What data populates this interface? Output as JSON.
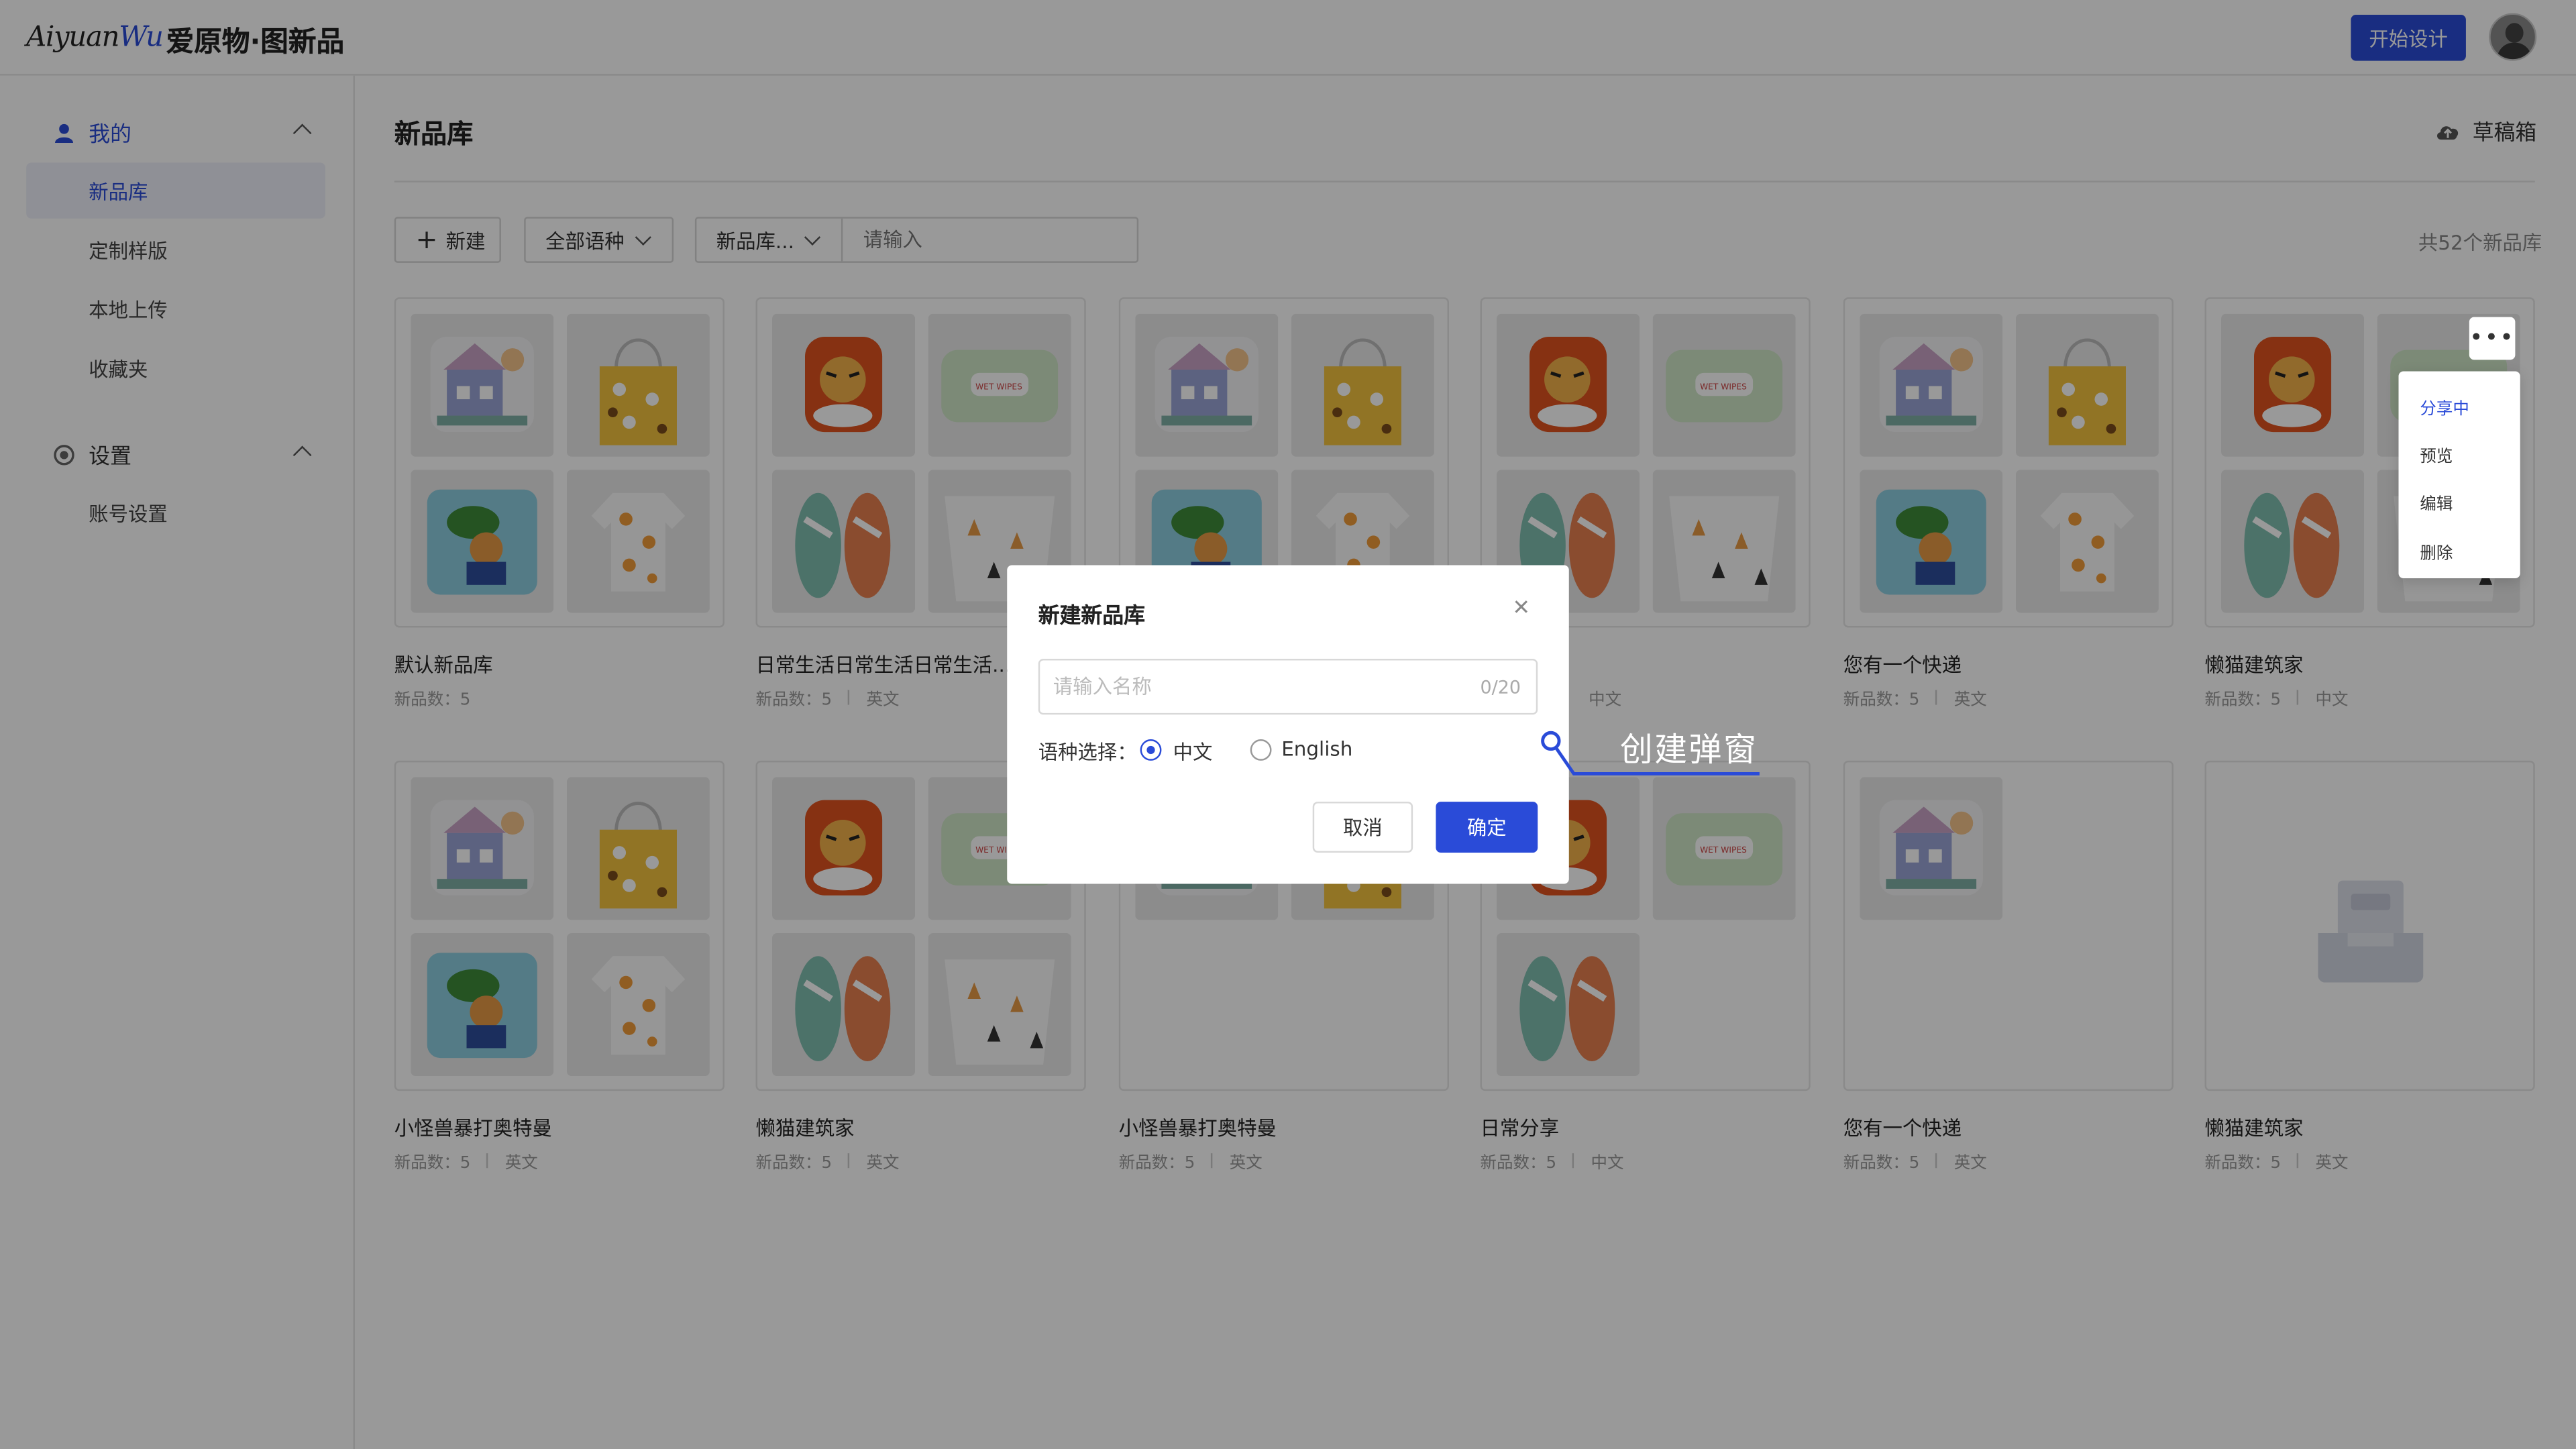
{
  "header": {
    "logo_script_a": "Aiyuan",
    "logo_script_b": "Wu",
    "logo_cn": "爱原物·图新品",
    "start_design": "开始设计"
  },
  "sidebar": {
    "group_mine": "我的",
    "items_mine": [
      "新品库",
      "定制样版",
      "本地上传",
      "收藏夹"
    ],
    "group_settings": "设置",
    "items_settings": [
      "账号设置"
    ]
  },
  "main": {
    "title": "新品库",
    "drafts": "草稿箱",
    "new_button": "新建",
    "language_filter": "全部语种",
    "search_type": "新品库...",
    "search_placeholder": "请输入",
    "total": "共52个新品库"
  },
  "cards": [
    {
      "title": "默认新品库",
      "count_label": "新品数：5",
      "lang": ""
    },
    {
      "title": "日常生活日常生活日常生活...",
      "count_label": "新品数：5",
      "lang": "英文"
    },
    {
      "title": "",
      "count_label": "",
      "lang": ""
    },
    {
      "title": "",
      "count_label": "",
      "lang": "中文"
    },
    {
      "title": "您有一个快递",
      "count_label": "新品数：5",
      "lang": "英文"
    },
    {
      "title": "懒猫建筑家",
      "count_label": "新品数：5",
      "lang": "中文"
    },
    {
      "title": "小怪兽暴打奥特曼",
      "count_label": "新品数：5",
      "lang": "英文"
    },
    {
      "title": "懒猫建筑家",
      "count_label": "新品数：5",
      "lang": "英文"
    },
    {
      "title": "小怪兽暴打奥特曼",
      "count_label": "新品数：5",
      "lang": "英文"
    },
    {
      "title": "日常分享",
      "count_label": "新品数：5",
      "lang": "中文"
    },
    {
      "title": "您有一个快递",
      "count_label": "新品数：5",
      "lang": "英文"
    },
    {
      "title": "懒猫建筑家",
      "count_label": "新品数：5",
      "lang": "英文"
    }
  ],
  "context_menu": {
    "items": [
      "分享中",
      "预览",
      "编辑",
      "删除"
    ]
  },
  "modal": {
    "title": "新建新品库",
    "name_placeholder": "请输入名称",
    "counter": "0/20",
    "language_label": "语种选择：",
    "option_cn": "中文",
    "option_en": "English",
    "cancel": "取消",
    "confirm": "确定"
  },
  "annotation": "创建弹窗",
  "colors": {
    "accent": "#2a4bd8",
    "overlay": "rgba(0,0,0,0.4)"
  }
}
